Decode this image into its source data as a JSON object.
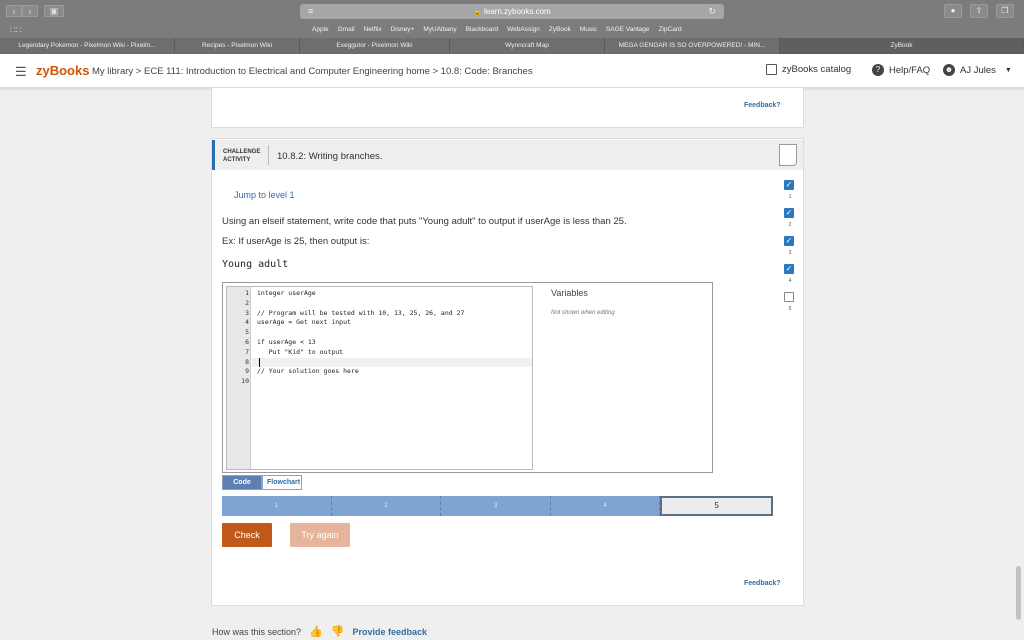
{
  "browser": {
    "url": "learn.zybooks.com",
    "bookmarks": [
      "Apple",
      "Gmail",
      "Netflix",
      "Disney+",
      "MyUAlbany",
      "Blackboard",
      "WebAssign",
      "ZyBook",
      "Music",
      "SAGE Vantage",
      "ZipCard"
    ],
    "tabs": [
      {
        "label": "Legendary Pokemon - Pixelmon Wiki - Pixelm...",
        "active": false
      },
      {
        "label": "Recipes - Pixelmon Wiki",
        "active": false
      },
      {
        "label": "Exeggutor - Pixelmon Wiki",
        "active": false
      },
      {
        "label": "Wynncraft Map",
        "active": false
      },
      {
        "label": "MEGA GENGAR IS SO OVERPOWERED! - MIN...",
        "active": false
      },
      {
        "label": "ZyBook",
        "active": true
      }
    ]
  },
  "header": {
    "logo": "zyBooks",
    "breadcrumb": "My library > ECE 111: Introduction to Electrical and Computer Engineering home > 10.8: Code: Branches",
    "catalog": "zyBooks catalog",
    "help": "Help/FAQ",
    "user": "AJ Jules"
  },
  "top_feedback": "Feedback?",
  "challenge": {
    "label_line1": "CHALLENGE",
    "label_line2": "ACTIVITY",
    "title": "10.8.2: Writing branches.",
    "jump": "Jump to level 1",
    "instruction": "Using an elseif statement, write code that puts \"Young adult\" to output if userAge is less than 25.",
    "example": "Ex: If userAge is 25, then output is:",
    "expected_output": "Young adult",
    "code_lines": [
      "integer userAge",
      "",
      "// Program will be tested with 10, 13, 25, 26, and 27",
      "userAge = Get next input",
      "",
      "if userAge < 13",
      "   Put \"Kid\" to output",
      "",
      "// Your solution goes here",
      ""
    ],
    "line_numbers": [
      "1",
      "2",
      "3",
      "4",
      "5",
      "6",
      "7",
      "8",
      "9",
      "10"
    ],
    "variables_title": "Variables",
    "variables_note": "Not shown when editing",
    "tab_code": "Code",
    "tab_flowchart": "Flowchart",
    "levels": [
      "1",
      "2",
      "3",
      "4",
      "5"
    ],
    "check_label": "Check",
    "try_again_label": "Try again",
    "feedback": "Feedback?",
    "level_checks": [
      {
        "num": "1",
        "done": true
      },
      {
        "num": "2",
        "done": true
      },
      {
        "num": "3",
        "done": true
      },
      {
        "num": "4",
        "done": true
      },
      {
        "num": "5",
        "done": false
      }
    ]
  },
  "footer": {
    "question": "How was this section?",
    "provide": "Provide feedback"
  }
}
